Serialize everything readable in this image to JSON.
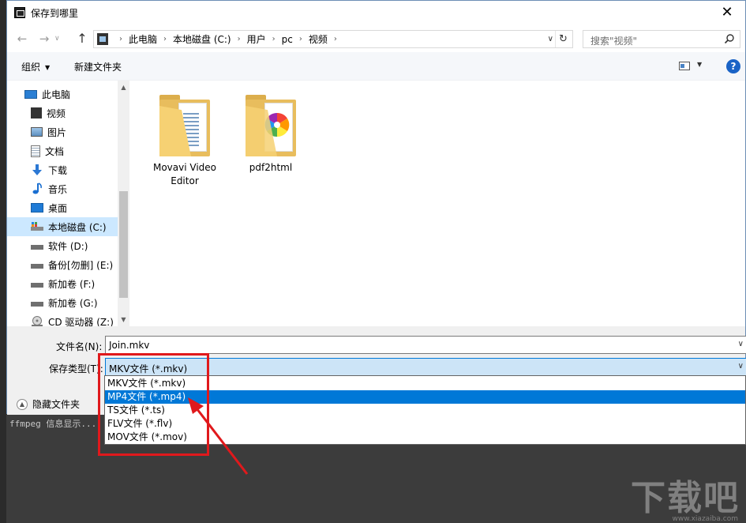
{
  "dialog": {
    "title": "保存到哪里",
    "close_glyph": "✕"
  },
  "nav": {
    "back_glyph": "←",
    "forward_glyph": "→",
    "recent_glyph": "∨",
    "up_glyph": "↑"
  },
  "address": {
    "crumbs": [
      "此电脑",
      "本地磁盘 (C:)",
      "用户",
      "pc",
      "视频"
    ],
    "sep_glyph": "›",
    "dropdown_glyph": "∨",
    "refresh_glyph": "↻"
  },
  "search": {
    "placeholder": "搜索\"视频\""
  },
  "toolbar": {
    "organize_label": "组织",
    "organize_caret": "▼",
    "new_folder_label": "新建文件夹",
    "view_caret": "▼",
    "help_label": "?"
  },
  "sidebar": {
    "scroll_up": "▲",
    "scroll_down": "▼",
    "items": [
      {
        "label": "此电脑",
        "icon": "computer-icon"
      },
      {
        "label": "视频",
        "icon": "video-icon"
      },
      {
        "label": "图片",
        "icon": "pictures-icon"
      },
      {
        "label": "文档",
        "icon": "documents-icon"
      },
      {
        "label": "下载",
        "icon": "download-icon"
      },
      {
        "label": "音乐",
        "icon": "music-icon"
      },
      {
        "label": "桌面",
        "icon": "desktop-icon"
      },
      {
        "label": "本地磁盘 (C:)",
        "icon": "drive-c-icon",
        "selected": true
      },
      {
        "label": "软件 (D:)",
        "icon": "drive-icon"
      },
      {
        "label": "备份[勿删] (E:)",
        "icon": "drive-icon"
      },
      {
        "label": "新加卷 (F:)",
        "icon": "drive-icon"
      },
      {
        "label": "新加卷 (G:)",
        "icon": "drive-icon"
      },
      {
        "label": "CD 驱动器 (Z:)",
        "icon": "cd-drive-icon"
      }
    ]
  },
  "files": [
    {
      "name": "Movavi Video\nEditor",
      "icon": "folder-icon"
    },
    {
      "name": "pdf2html",
      "icon": "folder-icon"
    }
  ],
  "form": {
    "filename_label": "文件名(N):",
    "filename_value": "Join.mkv",
    "filetype_label": "保存类型(T):",
    "filetype_value": "MKV文件 (*.mkv)",
    "dropdown_glyph": "∨",
    "hide_folders_label": "隐藏文件夹",
    "hide_folders_glyph": "▲"
  },
  "filetype_options": [
    {
      "label": "MKV文件 (*.mkv)",
      "highlighted": false
    },
    {
      "label": "MP4文件 (*.mp4)",
      "highlighted": true
    },
    {
      "label": "TS文件 (*.ts)",
      "highlighted": false
    },
    {
      "label": "FLV文件 (*.flv)",
      "highlighted": false
    },
    {
      "label": "MOV文件 (*.mov)",
      "highlighted": false
    }
  ],
  "background": {
    "console_text": "ffmpeg 信息显示..."
  },
  "watermark": {
    "text": "下载吧",
    "sub": "www.xiazaiba.com"
  },
  "colors": {
    "accent": "#0078d7",
    "selection": "#cce8ff",
    "annotation": "#e0191c",
    "folder": "#e8bd5d"
  }
}
